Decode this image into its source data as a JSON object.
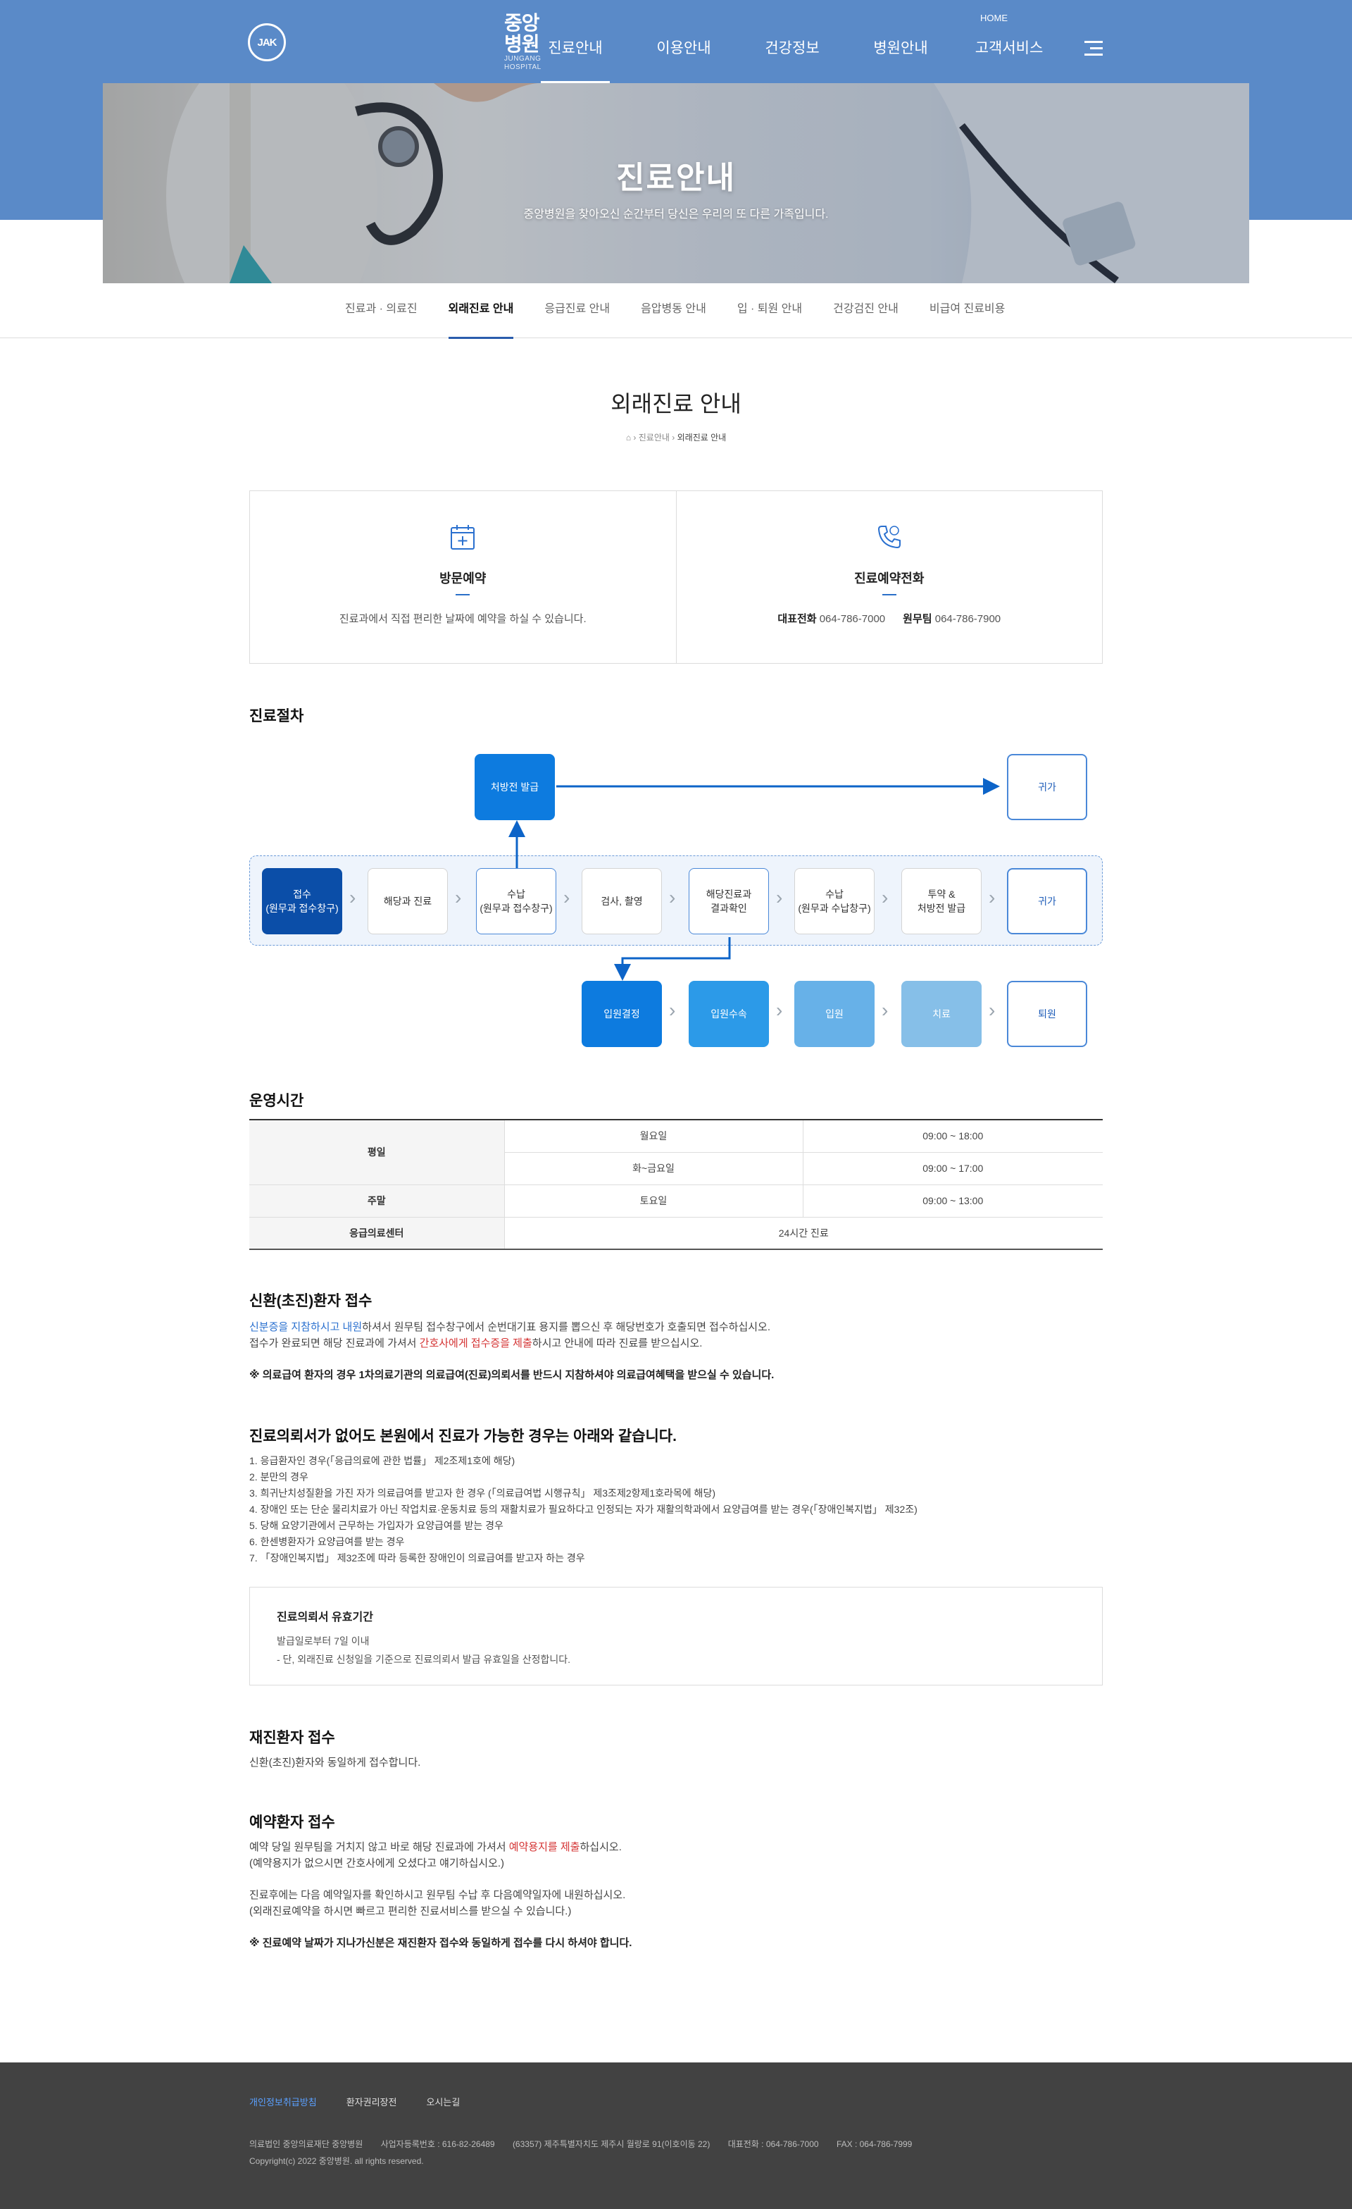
{
  "header": {
    "logo_mark": "JAK",
    "logo_name": "중앙병원",
    "logo_sub": "JUNGANG HOSPITAL",
    "home": "HOME",
    "nav": [
      {
        "label": "진료안내"
      },
      {
        "label": "이용안내"
      },
      {
        "label": "건강정보"
      },
      {
        "label": "병원안내"
      },
      {
        "label": "고객서비스"
      }
    ]
  },
  "hero": {
    "title": "진료안내",
    "subtitle": "중앙병원을 찾아오신 순간부터 당신은 우리의 또 다른 가족입니다."
  },
  "subnav": [
    {
      "label": "진료과 · 의료진"
    },
    {
      "label": "외래진료 안내"
    },
    {
      "label": "응급진료 안내"
    },
    {
      "label": "음압병동 안내"
    },
    {
      "label": "입 · 퇴원 안내"
    },
    {
      "label": "건강검진 안내"
    },
    {
      "label": "비급여 진료비용"
    }
  ],
  "page": {
    "title": "외래진료 안내",
    "breadcrumb": [
      "진료안내",
      "외래진료 안내"
    ]
  },
  "reserve": {
    "visit": {
      "title": "방문예약",
      "desc": "진료과에서 직접 편리한 날짜에 예약을 하실 수 있습니다."
    },
    "phone": {
      "title": "진료예약전화",
      "main_label": "대표전화",
      "main_num": "064-786-7000",
      "desk_label": "원무팀",
      "desk_num": "064-786-7900"
    }
  },
  "flow": {
    "heading": "진료절차",
    "prescription": "처방전 발급",
    "home1": "귀가",
    "receipt": [
      "접수",
      "(원무과 접수창구)"
    ],
    "dept": "해당과 진료",
    "pay1": [
      "수납",
      "(원무과 접수창구)"
    ],
    "exam": "검사, 촬영",
    "result": [
      "해당진료과",
      "결과확인"
    ],
    "pay2": [
      "수납",
      "(원무과 수납창구)"
    ],
    "drug": [
      "투약 &",
      "처방전 발급"
    ],
    "home2": "귀가",
    "admit_decide": "입원결정",
    "admit_proc": "입원수속",
    "admit": "입원",
    "treat": "치료",
    "discharge": "퇴원"
  },
  "hours": {
    "heading": "운영시간",
    "weekday": "평일",
    "weekend": "주말",
    "er": "응급의료센터",
    "mon": "월요일",
    "mon_time": "09:00 ~ 18:00",
    "tue_fri": "화~금요일",
    "tue_fri_time": "09:00 ~ 17:00",
    "sat": "토요일",
    "sat_time": "09:00 ~ 13:00",
    "er_time": "24시간 진료"
  },
  "new_patient": {
    "heading": "신환(초진)환자 접수",
    "l1a": "신분증을 지참하시고 내원",
    "l1b": "하셔서 원무팀 접수창구에서 순번대기표 용지를 뽑으신 후 해당번호가 호출되면 접수하십시오.",
    "l2a": "접수가 완료되면 해당 진료과에 가셔서 ",
    "l2b": "간호사에게 접수증을 제출",
    "l2c": "하시고 안내에 따라 진료를 받으십시오.",
    "note": "※ 의료급여 환자의 경우 1차의료기관의 의료급여(진료)의뢰서를 반드시 지참하셔야 의료급여혜택을 받으실 수 있습니다."
  },
  "referral": {
    "heading": "진료의뢰서가 없어도 본원에서 진료가 가능한 경우는 아래와 같습니다.",
    "items": [
      "1. 응급환자인 경우(「응급의료에 관한 법률」 제2조제1호에 해당)",
      "2. 분만의 경우",
      "3. 희귀난치성질환을 가진 자가 의료급여를 받고자 한 경우 (「의료급여법 시행규칙」 제3조제2항제1호라목에 해당)",
      "4. 장애인 또는 단순 물리치료가 아닌 작업치료·운동치료 등의 재활치료가 필요하다고 인정되는 자가 재활의학과에서 요양급여를 받는 경우(「장애인복지법」 제32조)",
      "5. 당해 요양기관에서 근무하는 가입자가 요양급여를 받는 경우",
      "6. 한센병환자가 요양급여를 받는 경우",
      "7. 「장애인복지법」 제32조에 따라 등록한 장애인이 의료급여를 받고자 하는 경우"
    ],
    "validity_title": "진료의뢰서 유효기간",
    "validity_l1": "발급일로부터 7일 이내",
    "validity_l2": "- 단, 외래진료 신청일을 기준으로 진료의뢰서 발급 유효일을 산정합니다."
  },
  "return_patient": {
    "heading": "재진환자 접수",
    "text": "신환(초진)환자와 동일하게 접수합니다."
  },
  "reserved_patient": {
    "heading": "예약환자 접수",
    "l1a": "예약 당일 원무팀을 거치지 않고 바로 해당 진료과에 가셔서 ",
    "l1b": "예약용지를 제출",
    "l1c": "하십시오.",
    "l2": "(예약용지가 없으시면 간호사에게 오셨다고 얘기하십시오.)",
    "l3": "진료후에는 다음 예약일자를 확인하시고 원무팀 수납 후 다음예약일자에 내원하십시오.",
    "l4": "(외래진료예약을 하시면 빠르고 편리한 진료서비스를 받으실 수 있습니다.)",
    "note": "※ 진료예약 날짜가 지나가신분은 재진환자 접수와 동일하게 접수를 다시 하셔야 합니다."
  },
  "footer": {
    "links": [
      "개인정보취급방침",
      "환자권리장전",
      "오시는길"
    ],
    "info": [
      "의료법인 중앙의료재단 중앙병원",
      "사업자등록번호 : 616-82-26489",
      "(63357) 제주특별자치도 제주시 월랑로 91(이호이동 22)",
      "대표전화 : 064-786-7000",
      "FAX : 064-786-7999"
    ],
    "copyright": "Copyright(c) 2022 중앙병원. all rights reserved."
  },
  "colors": {
    "header_bg": "#5a8ac8",
    "accent": "#2a5cad",
    "footer_bg": "#424242"
  }
}
